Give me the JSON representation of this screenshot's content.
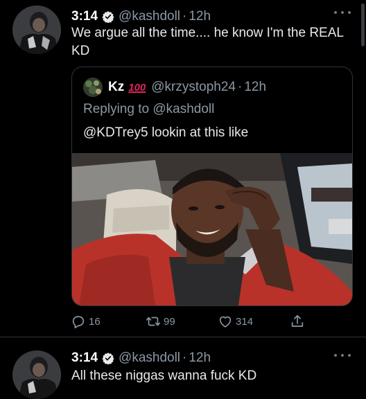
{
  "colors": {
    "background": "#000000",
    "primary_text": "#e7e9ea",
    "secondary_text": "#8b98a5",
    "verified_badge": "#e7e9ea",
    "border": "#2f3336"
  },
  "tweets": [
    {
      "time": "3:14",
      "handle": "@kashdoll",
      "separator": "·",
      "ago": "12h",
      "text": "We argue all the time.... he know I'm the REAL KD",
      "quote": {
        "name": "Kz",
        "emoji": "100",
        "handle": "@krzystoph24",
        "separator": "·",
        "ago": "12h",
        "replying_to": "Replying to @kashdoll",
        "text": "@KDTrey5 lookin at this like"
      },
      "actions": {
        "replies": "16",
        "retweets": "99",
        "likes": "314"
      }
    },
    {
      "time": "3:14",
      "handle": "@kashdoll",
      "separator": "·",
      "ago": "12h",
      "text": "All these niggas wanna fuck KD"
    }
  ],
  "icons": {
    "verified": "verified-badge-icon",
    "more": "more-dots-icon",
    "reply": "reply-bubble-icon",
    "retweet": "retweet-icon",
    "like": "heart-icon",
    "share": "share-icon"
  }
}
